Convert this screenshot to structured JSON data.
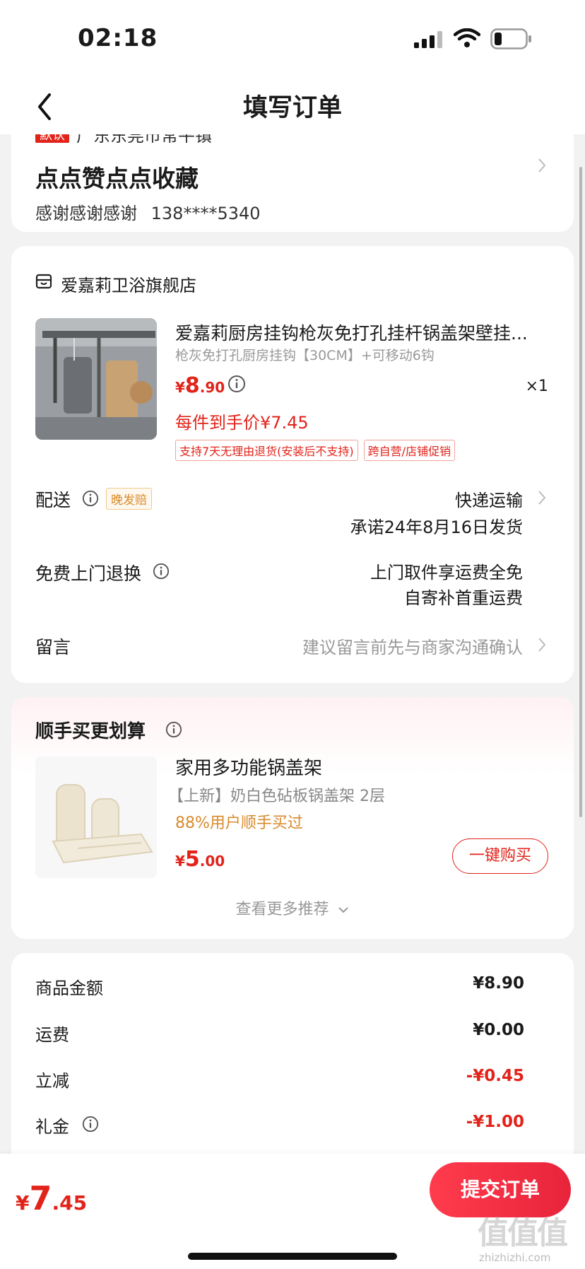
{
  "status_bar": {
    "time": "02:18"
  },
  "nav": {
    "title": "填写订单"
  },
  "address": {
    "default_tag": "默认",
    "region": "广东东莞市常平镇",
    "name": "点点赞点点收藏",
    "contact_name": "感谢感谢感谢",
    "phone": "138****5340"
  },
  "order": {
    "shop_name": "爱嘉莉卫浴旗舰店",
    "product": {
      "title": "爱嘉莉厨房挂钩枪灰免打孔挂杆锅盖架壁挂...",
      "spec": "枪灰免打孔厨房挂钩【30CM】+可移动6钩",
      "price_symbol": "¥",
      "price_int": "8",
      "price_dec": ".90",
      "qty": "×1",
      "final_price": "每件到手价¥7.45",
      "tags": [
        "支持7天无理由退货(安装后不支持)",
        "跨自营/店铺促销"
      ]
    },
    "delivery": {
      "label": "配送",
      "tag": "晚发赔",
      "method": "快递运输",
      "promise": "承诺24年8月16日发货"
    },
    "return": {
      "label": "免费上门退换",
      "line1": "上门取件享运费全免",
      "line2": "自寄补首重运费"
    },
    "message": {
      "label": "留言",
      "placeholder": "建议留言前先与商家沟通确认"
    }
  },
  "recommend": {
    "title": "顺手买更划算",
    "item": {
      "name": "家用多功能锅盖架",
      "spec": "【上新】奶白色砧板锅盖架 2层",
      "buy_rate": "88%用户顺手买过",
      "price_symbol": "¥",
      "price_int": "5",
      "price_dec": ".00",
      "buy_label": "一键购买"
    },
    "more_label": "查看更多推荐"
  },
  "amounts": [
    {
      "label": "商品金额",
      "value": "¥8.90"
    },
    {
      "label": "运费",
      "value": "¥0.00"
    },
    {
      "label": "立减",
      "value": "-¥0.45"
    },
    {
      "label": "礼金",
      "value": "-¥1.00"
    }
  ],
  "bottom": {
    "total_symbol": "¥",
    "total_int": "7",
    "total_dec": ".45",
    "submit_label": "提交订单",
    "watermark": "值值值",
    "watermark_url": "zhizhizhi.com"
  },
  "colors": {
    "accent": "#e2231a",
    "orange": "#d98a2b"
  },
  "icons": [
    "signal-icon",
    "wifi-icon",
    "battery-icon",
    "back-icon",
    "chevron-right-icon",
    "shop-icon",
    "info-icon",
    "chevron-down-icon"
  ]
}
